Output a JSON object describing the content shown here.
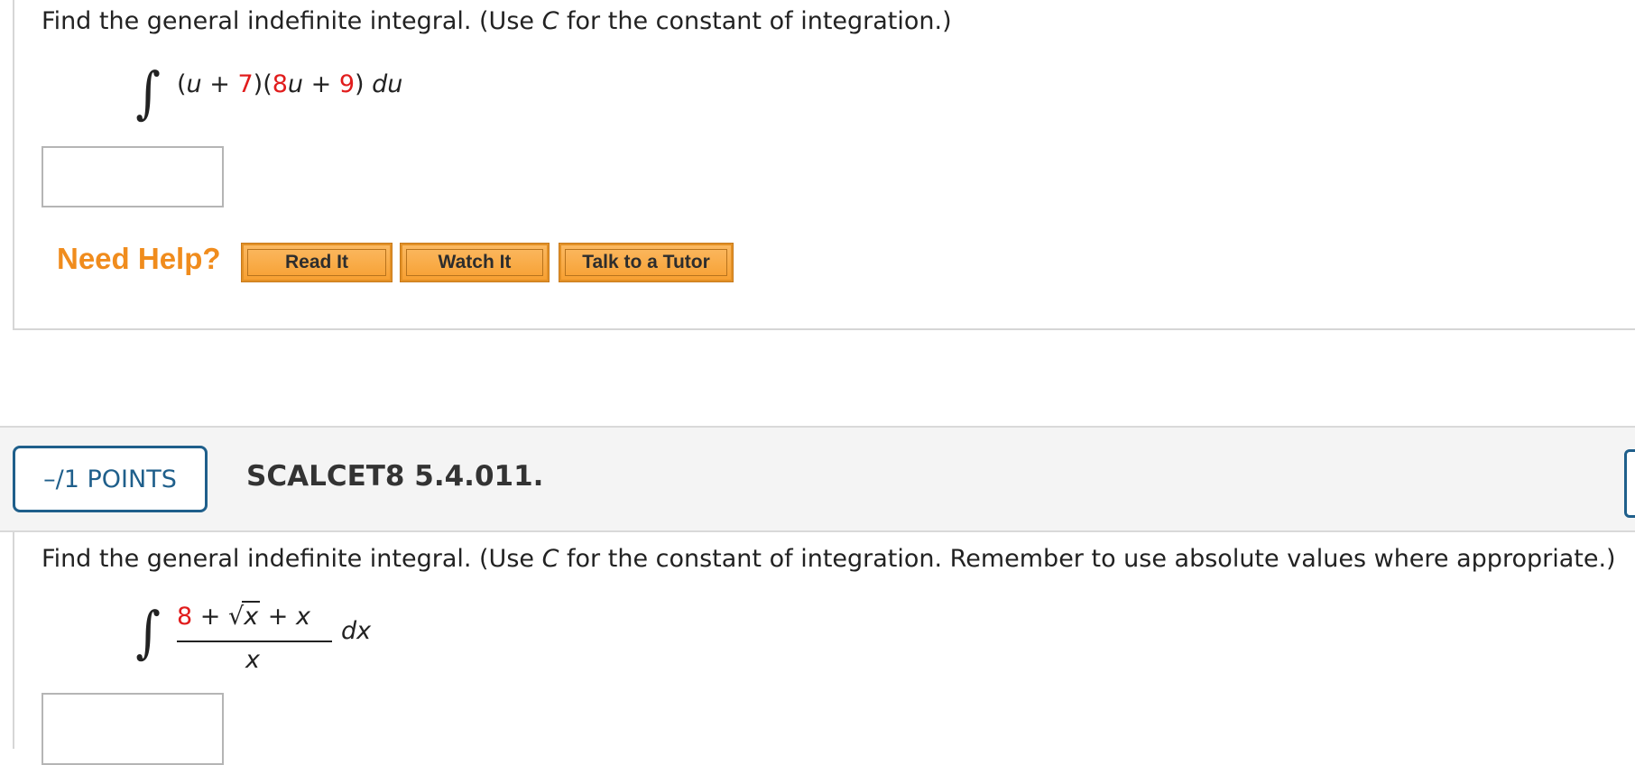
{
  "question1": {
    "prompt_before_c": "Find the general indefinite integral. (Use ",
    "prompt_c": "C",
    "prompt_after_c": " for the constant of integration.)",
    "integral_sign": "∫",
    "expr": {
      "p1": "(",
      "u1": "u",
      "p2": " + ",
      "n7": "7",
      "p3": ")(",
      "n8": "8",
      "u2": "u",
      "p4": " + ",
      "n9": "9",
      "p5": ") ",
      "du": "du"
    },
    "answer_value": "",
    "need_help": "Need Help?",
    "buttons": [
      "Read It",
      "Watch It",
      "Talk to a Tutor"
    ]
  },
  "question2": {
    "points": "–/1 POINTS",
    "id": "SCALCET8 5.4.011.",
    "prompt_before_c": "Find the general indefinite integral. (Use ",
    "prompt_c": "C",
    "prompt_after_c": " for the constant of integration. Remember to use absolute values where appropriate.)",
    "integral_sign": "∫",
    "numerator": {
      "n8": "8",
      "plus1": " + ",
      "sqrt": "√",
      "x1": "x",
      "plus2": " + ",
      "x2": "x"
    },
    "denominator": "x",
    "dx": "dx",
    "answer_value": ""
  },
  "colors": {
    "red_number": "#e11c1c",
    "need_help": "#f08c1d",
    "button_orange": "#f7a032",
    "points_blue": "#1f5f8b"
  }
}
